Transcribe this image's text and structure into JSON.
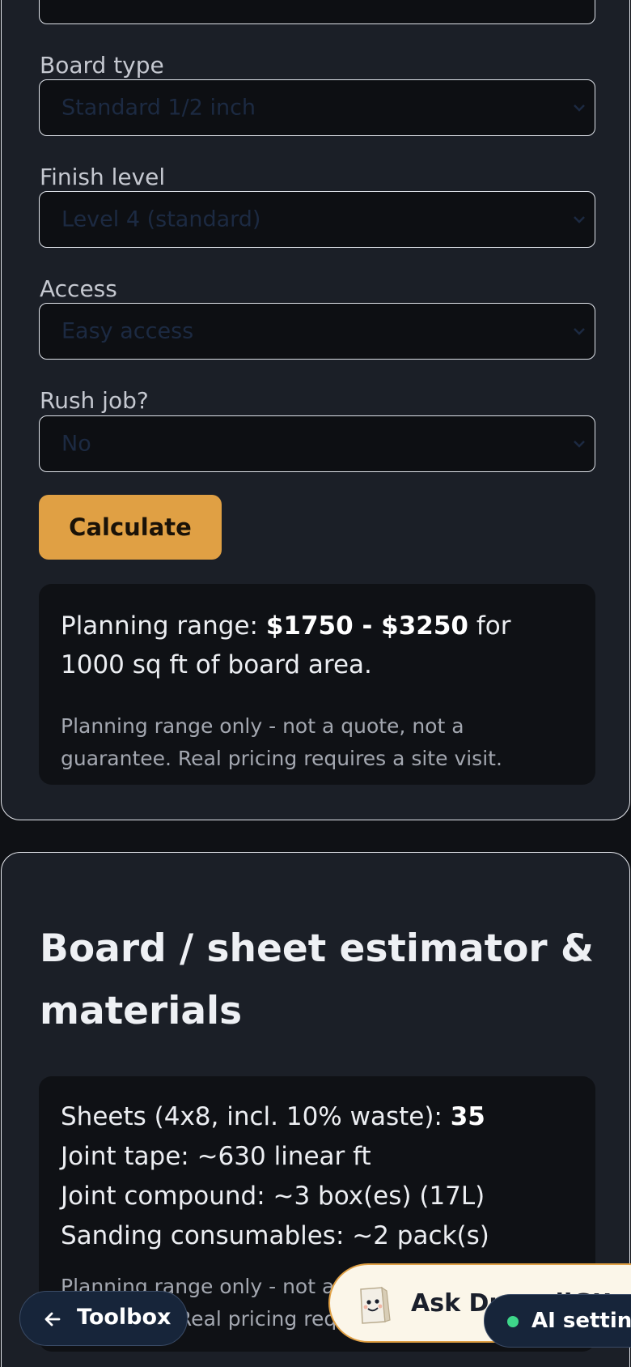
{
  "form": {
    "fields": [
      {
        "label": "Board type",
        "value": "Standard 1/2 inch"
      },
      {
        "label": "Finish level",
        "value": "Level 4 (standard)"
      },
      {
        "label": "Access",
        "value": "Easy access"
      },
      {
        "label": "Rush job?",
        "value": "No"
      }
    ],
    "calculate_label": "Calculate"
  },
  "estimate": {
    "prefix": "Planning range: ",
    "range": "$1750 - $3250",
    "suffix": " for 1000 sq ft of board area.",
    "disclaimer": "Planning range only - not a quote, not a guarantee. Real pricing requires a site visit."
  },
  "materials": {
    "title": "Board / sheet estimator & materials",
    "sheets_label": "Sheets (4x8, incl. 10% waste): ",
    "sheets_value": "35",
    "lines": [
      "Joint tape: ~630 linear ft",
      "Joint compound: ~3 box(es) (17L)",
      "Sanding consumables: ~2 pack(s)"
    ],
    "disclaimer": "Planning range only - not a quote, not a guarantee. Real pricing requires a site visit."
  },
  "floating": {
    "toolbox_label": "Toolbox",
    "ask_label": "Ask DrywallGU",
    "ai_label": "AI settings",
    "ai_status_color": "#3ed68a"
  },
  "icons": {
    "chevron": "chevron-down-icon",
    "arrow": "arrow-left-icon",
    "avatar": "drywall-sheet-mascot-icon"
  }
}
